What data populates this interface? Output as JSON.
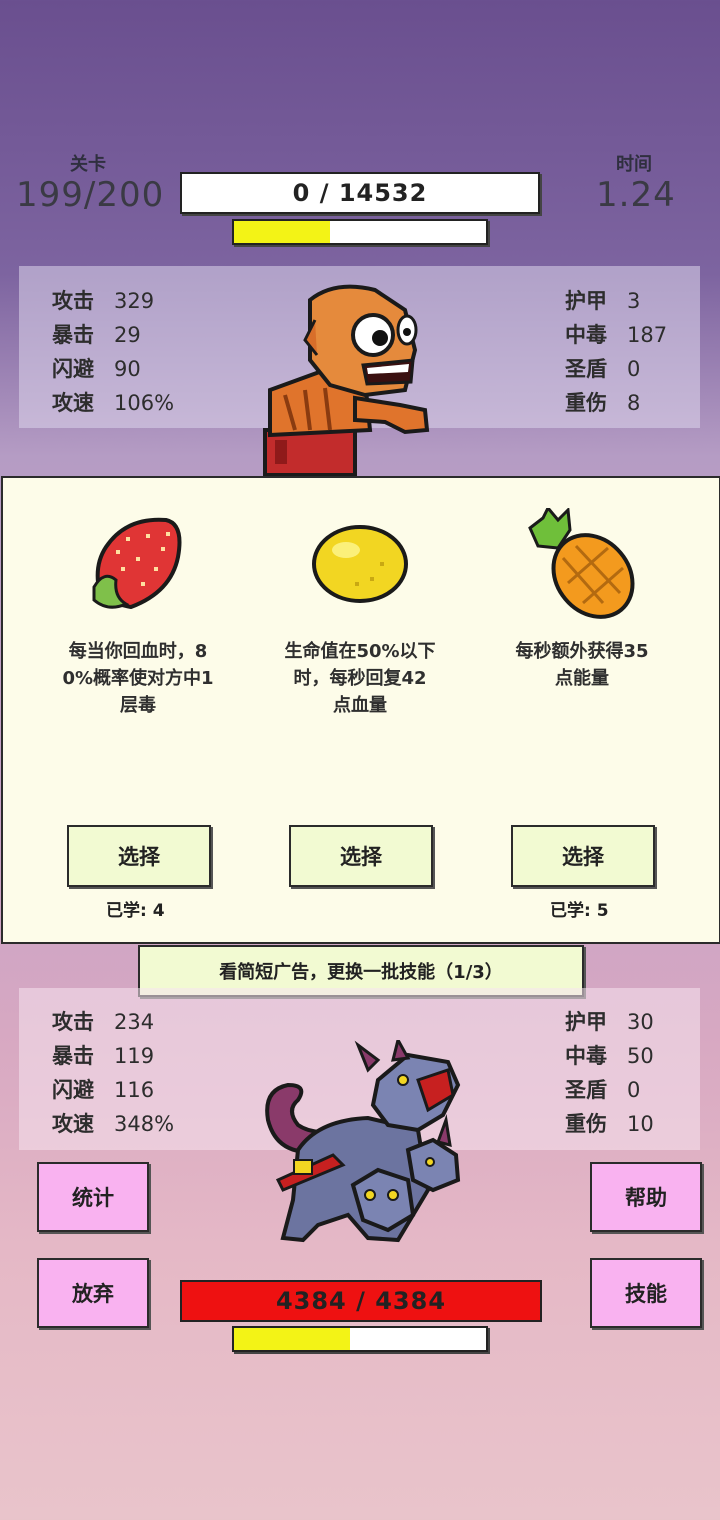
{
  "header": {
    "level_label": "关卡",
    "level_value": "199/200",
    "time_label": "时间",
    "time_value": "1.24",
    "score_text": "0 / 14532",
    "top_energy_progress": 0.38
  },
  "player": {
    "left_stats": [
      {
        "label": "攻击",
        "value": "329"
      },
      {
        "label": "暴击",
        "value": "29"
      },
      {
        "label": "闪避",
        "value": "90"
      },
      {
        "label": "攻速",
        "value": "106%"
      }
    ],
    "right_stats": [
      {
        "label": "护甲",
        "value": "3"
      },
      {
        "label": "中毒",
        "value": "187"
      },
      {
        "label": "圣盾",
        "value": "0"
      },
      {
        "label": "重伤",
        "value": "8"
      }
    ]
  },
  "skills": [
    {
      "icon": "strawberry-icon",
      "desc_lines": [
        "每当你回血时，8",
        "0%概率使对方中1",
        "层毒"
      ],
      "button": "选择",
      "learned": "已学: 4"
    },
    {
      "icon": "lemon-icon",
      "desc_lines": [
        "生命值在50%以下",
        "时，每秒回复42",
        "点血量"
      ],
      "button": "选择",
      "learned": ""
    },
    {
      "icon": "pineapple-icon",
      "desc_lines": [
        "每秒额外获得35",
        "点能量"
      ],
      "button": "选择",
      "learned": "已学: 5"
    }
  ],
  "ad_refresh": "看简短广告，更换一批技能（1/3）",
  "enemy": {
    "left_stats": [
      {
        "label": "攻击",
        "value": "234"
      },
      {
        "label": "暴击",
        "value": "119"
      },
      {
        "label": "闪避",
        "value": "116"
      },
      {
        "label": "攻速",
        "value": "348%"
      }
    ],
    "right_stats": [
      {
        "label": "护甲",
        "value": "30"
      },
      {
        "label": "中毒",
        "value": "50"
      },
      {
        "label": "圣盾",
        "value": "0"
      },
      {
        "label": "重伤",
        "value": "10"
      }
    ],
    "hp_text": "4384 / 4384",
    "energy_progress": 0.46
  },
  "buttons": {
    "stats": "统计",
    "help": "帮助",
    "give_up": "放弃",
    "skills": "技能"
  },
  "colors": {
    "hp_bar": "#ee1111",
    "energy_fill": "#f3f316",
    "pink_button": "#f9b2f0",
    "select_button": "#f2fad2"
  }
}
